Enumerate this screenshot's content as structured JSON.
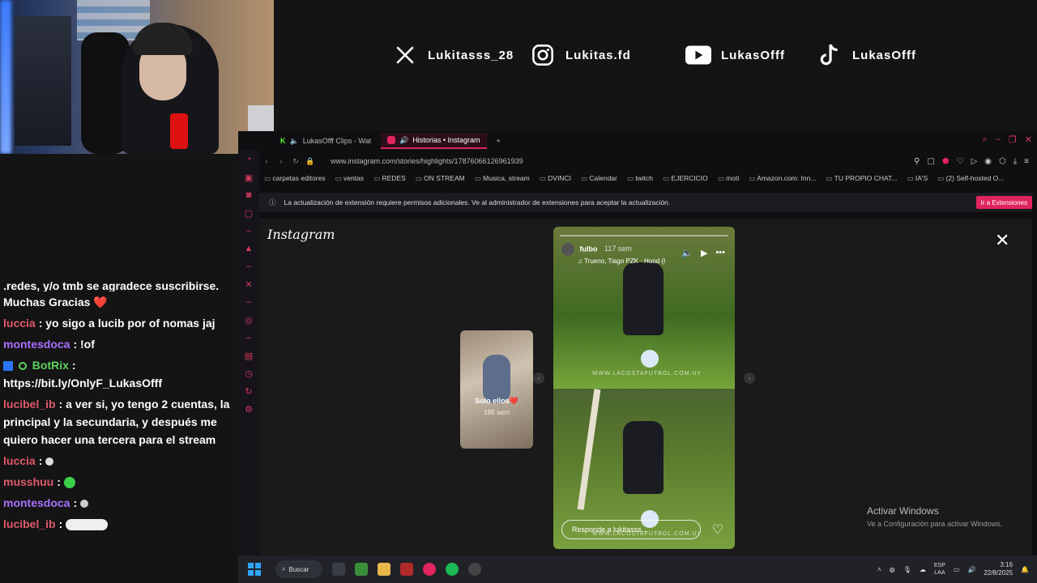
{
  "socials": [
    {
      "icon": "x-logo-icon",
      "handle": "Lukitasss_28"
    },
    {
      "icon": "instagram-icon",
      "handle": "Lukitas.fd"
    },
    {
      "icon": "youtube-icon",
      "handle": "LukasOfff"
    },
    {
      "icon": "tiktok-icon",
      "handle": "LukasOfff"
    }
  ],
  "chat": {
    "lines": [
      {
        "user": "",
        "color": "#ffffff",
        "text": ".redes, y/o tmb se agradece suscribirse."
      },
      {
        "user": "",
        "color": "#ffffff",
        "text": "Muchas Gracias ❤️"
      },
      {
        "user": "luccia",
        "color": "#e05a6a",
        "text": ": yo sigo a lucib por of nomas jaj"
      },
      {
        "user": "montesdoca",
        "color": "#a970ff",
        "text": ": !of"
      },
      {
        "user": "BotRix",
        "color": "#5fd35f",
        "text": ": https://bit.ly/OnlyF_LukasOfff"
      },
      {
        "user": "lucibel_ib",
        "color": "#e05a6a",
        "text": ": a ver si, yo tengo 2 cuentas, la principal y la secundaria, y después me quiero hacer una tercera para el stream"
      },
      {
        "user": "luccia",
        "color": "#e05a6a",
        "text": ":"
      },
      {
        "user": "musshuu",
        "color": "#e05a6a",
        "text": ":"
      },
      {
        "user": "montesdoca",
        "color": "#a970ff",
        "text": ":"
      },
      {
        "user": "lucibel_ib",
        "color": "#e05a6a",
        "text": ":"
      }
    ]
  },
  "browser": {
    "tabs": [
      {
        "label": "LukasOfff Clips - Wat",
        "active": false
      },
      {
        "label": "Historias • Instagram",
        "active": true
      }
    ],
    "url": "www.instagram.com/stories/highlights/17876066126961939",
    "bookmarks": [
      "carpetas editores",
      "ventas",
      "REDES",
      "ON STREAM",
      "Musica, stream",
      "DVINCI",
      "Calendar",
      "twitch",
      "EJERCICIO",
      "moti",
      "Amazon.com: Inn...",
      "TU PROPIO CHAT...",
      "IA'S",
      "(2) Self-hosted O..."
    ],
    "notice": "La actualización de extensión requiere permisos adicionales. Ve al administrador de extensiones para aceptar la actualización.",
    "notice_button": "Ir a Extensiones"
  },
  "instagram": {
    "logo": "Instagram",
    "preview": {
      "title": "Solo ellos❤️",
      "ago": "195 sem"
    },
    "story": {
      "user": "fulbo",
      "ago": "117 sem",
      "song": "Trueno, Tiago PZK · Hood (I",
      "watermark": "WWW.LACOSTAFUTBOL.COM.UY",
      "reply_placeholder": "Responde a lukitasss..."
    }
  },
  "windows_notice": {
    "title": "Activar Windows",
    "subtitle": "Ve a Configuración para activar Windows."
  },
  "taskbar": {
    "search": "Buscar",
    "lang1": "ESP",
    "lang2": "LAA",
    "time": "3:16",
    "date": "22/8/2025"
  },
  "colors": {
    "accent": "#e0245e",
    "bg": "#141414"
  }
}
